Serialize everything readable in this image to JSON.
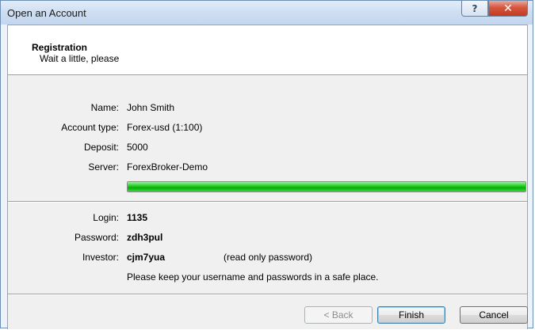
{
  "window": {
    "title": "Open an Account",
    "help_glyph": "?",
    "close_glyph": "✕"
  },
  "header": {
    "title": "Registration",
    "subtitle": "Wait a little, please"
  },
  "details": {
    "name_label": "Name:",
    "name_value": "John Smith",
    "account_type_label": "Account type:",
    "account_type_value": "Forex-usd (1:100)",
    "deposit_label": "Deposit:",
    "deposit_value": "5000",
    "server_label": "Server:",
    "server_value": "ForexBroker-Demo"
  },
  "progress": {
    "fraction": 1.0
  },
  "credentials": {
    "login_label": "Login:",
    "login_value": "1135",
    "password_label": "Password:",
    "password_value": "zdh3pul",
    "investor_label": "Investor:",
    "investor_value": "cjm7yua",
    "investor_note": "(read only password)",
    "safety_note": "Please keep your username and passwords in a safe place."
  },
  "buttons": {
    "back": "< Back",
    "finish": "Finish",
    "cancel": "Cancel"
  },
  "colors": {
    "progress_green": "#06b006",
    "close_red": "#c23a22"
  }
}
